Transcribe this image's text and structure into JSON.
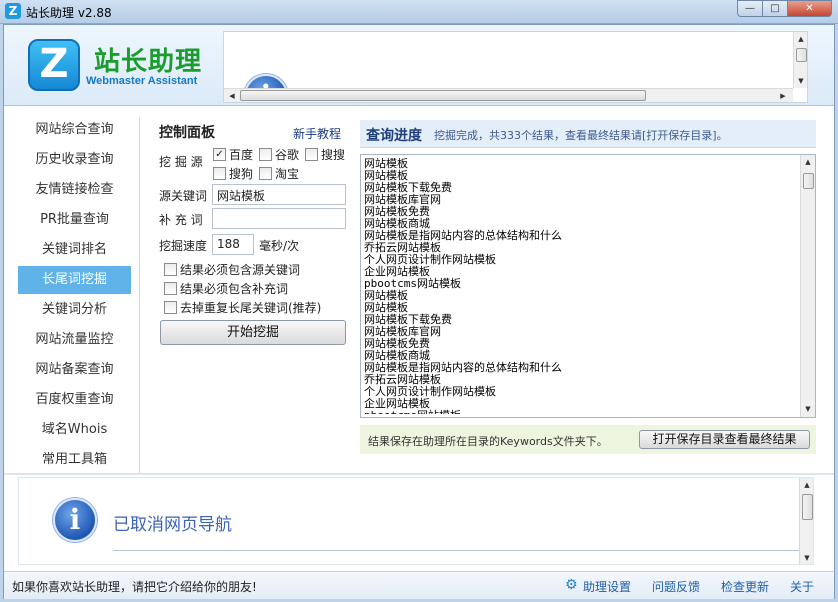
{
  "window": {
    "logo_letter": "Z",
    "title": "站长助理 v2.88",
    "min_label": "—",
    "max_label": "□",
    "close_label": "✕"
  },
  "header": {
    "logo_letter": "Z",
    "brand_cn": "站长助理",
    "brand_en": "Webmaster Assistant",
    "nav_message": "已取消网页导航"
  },
  "sidebar": {
    "items": [
      {
        "label": "网站综合查询"
      },
      {
        "label": "历史收录查询"
      },
      {
        "label": "友情链接检查"
      },
      {
        "label": "PR批量查询"
      },
      {
        "label": "关键词排名"
      },
      {
        "label": "长尾词挖掘",
        "active": true
      },
      {
        "label": "关键词分析"
      },
      {
        "label": "网站流量监控"
      },
      {
        "label": "网站备案查询"
      },
      {
        "label": "百度权重查询"
      },
      {
        "label": "域名Whois"
      },
      {
        "label": "常用工具箱"
      }
    ]
  },
  "control": {
    "title": "控制面板",
    "tutorial_link": "新手教程",
    "source_label": "挖 掘 源",
    "sources": [
      {
        "label": "百度",
        "checked": true
      },
      {
        "label": "谷歌",
        "checked": false
      },
      {
        "label": "搜搜",
        "checked": false
      },
      {
        "label": "搜狗",
        "checked": false
      },
      {
        "label": "淘宝",
        "checked": false
      }
    ],
    "source_keyword_label": "源关键词",
    "source_keyword_value": "网站模板",
    "supplement_label": "补 充 词",
    "supplement_value": "",
    "speed_label": "挖掘速度",
    "speed_value": "188",
    "speed_unit": "毫秒/次",
    "options": [
      {
        "label": "结果必须包含源关键词",
        "checked": false
      },
      {
        "label": "结果必须包含补充词",
        "checked": false
      },
      {
        "label": "去掉重复长尾关键词(推荐)",
        "checked": false
      }
    ],
    "start_button": "开始挖掘"
  },
  "progress": {
    "title": "查询进度",
    "status": "挖掘完成，共333个结果，查看最终结果请[打开保存目录]。",
    "results": [
      "网站模板",
      "网站模板",
      "网站模板下载免费",
      "网站模板库官网",
      "网站模板免费",
      "网站模板商城",
      "网站模板是指网站内容的总体结构和什么",
      "乔拓云网站模板",
      "个人网页设计制作网站模板",
      "企业网站模板",
      "pbootcms网站模板",
      "网站模板",
      "网站模板",
      "网站模板下载免费",
      "网站模板库官网",
      "网站模板免费",
      "网站模板商城",
      "网站模板是指网站内容的总体结构和什么",
      "乔拓云网站模板",
      "个人网页设计制作网站模板",
      "企业网站模板",
      "pbootcms网站模板"
    ],
    "save_note": "结果保存在助理所在目录的Keywords文件夹下。",
    "open_button": "打开保存目录查看最终结果"
  },
  "bottom": {
    "message": "已取消网页导航"
  },
  "statusbar": {
    "left_text": "如果你喜欢站长助理，请把它介绍给你的朋友!",
    "settings": "助理设置",
    "feedback": "问题反馈",
    "update": "检查更新",
    "about": "关于"
  }
}
